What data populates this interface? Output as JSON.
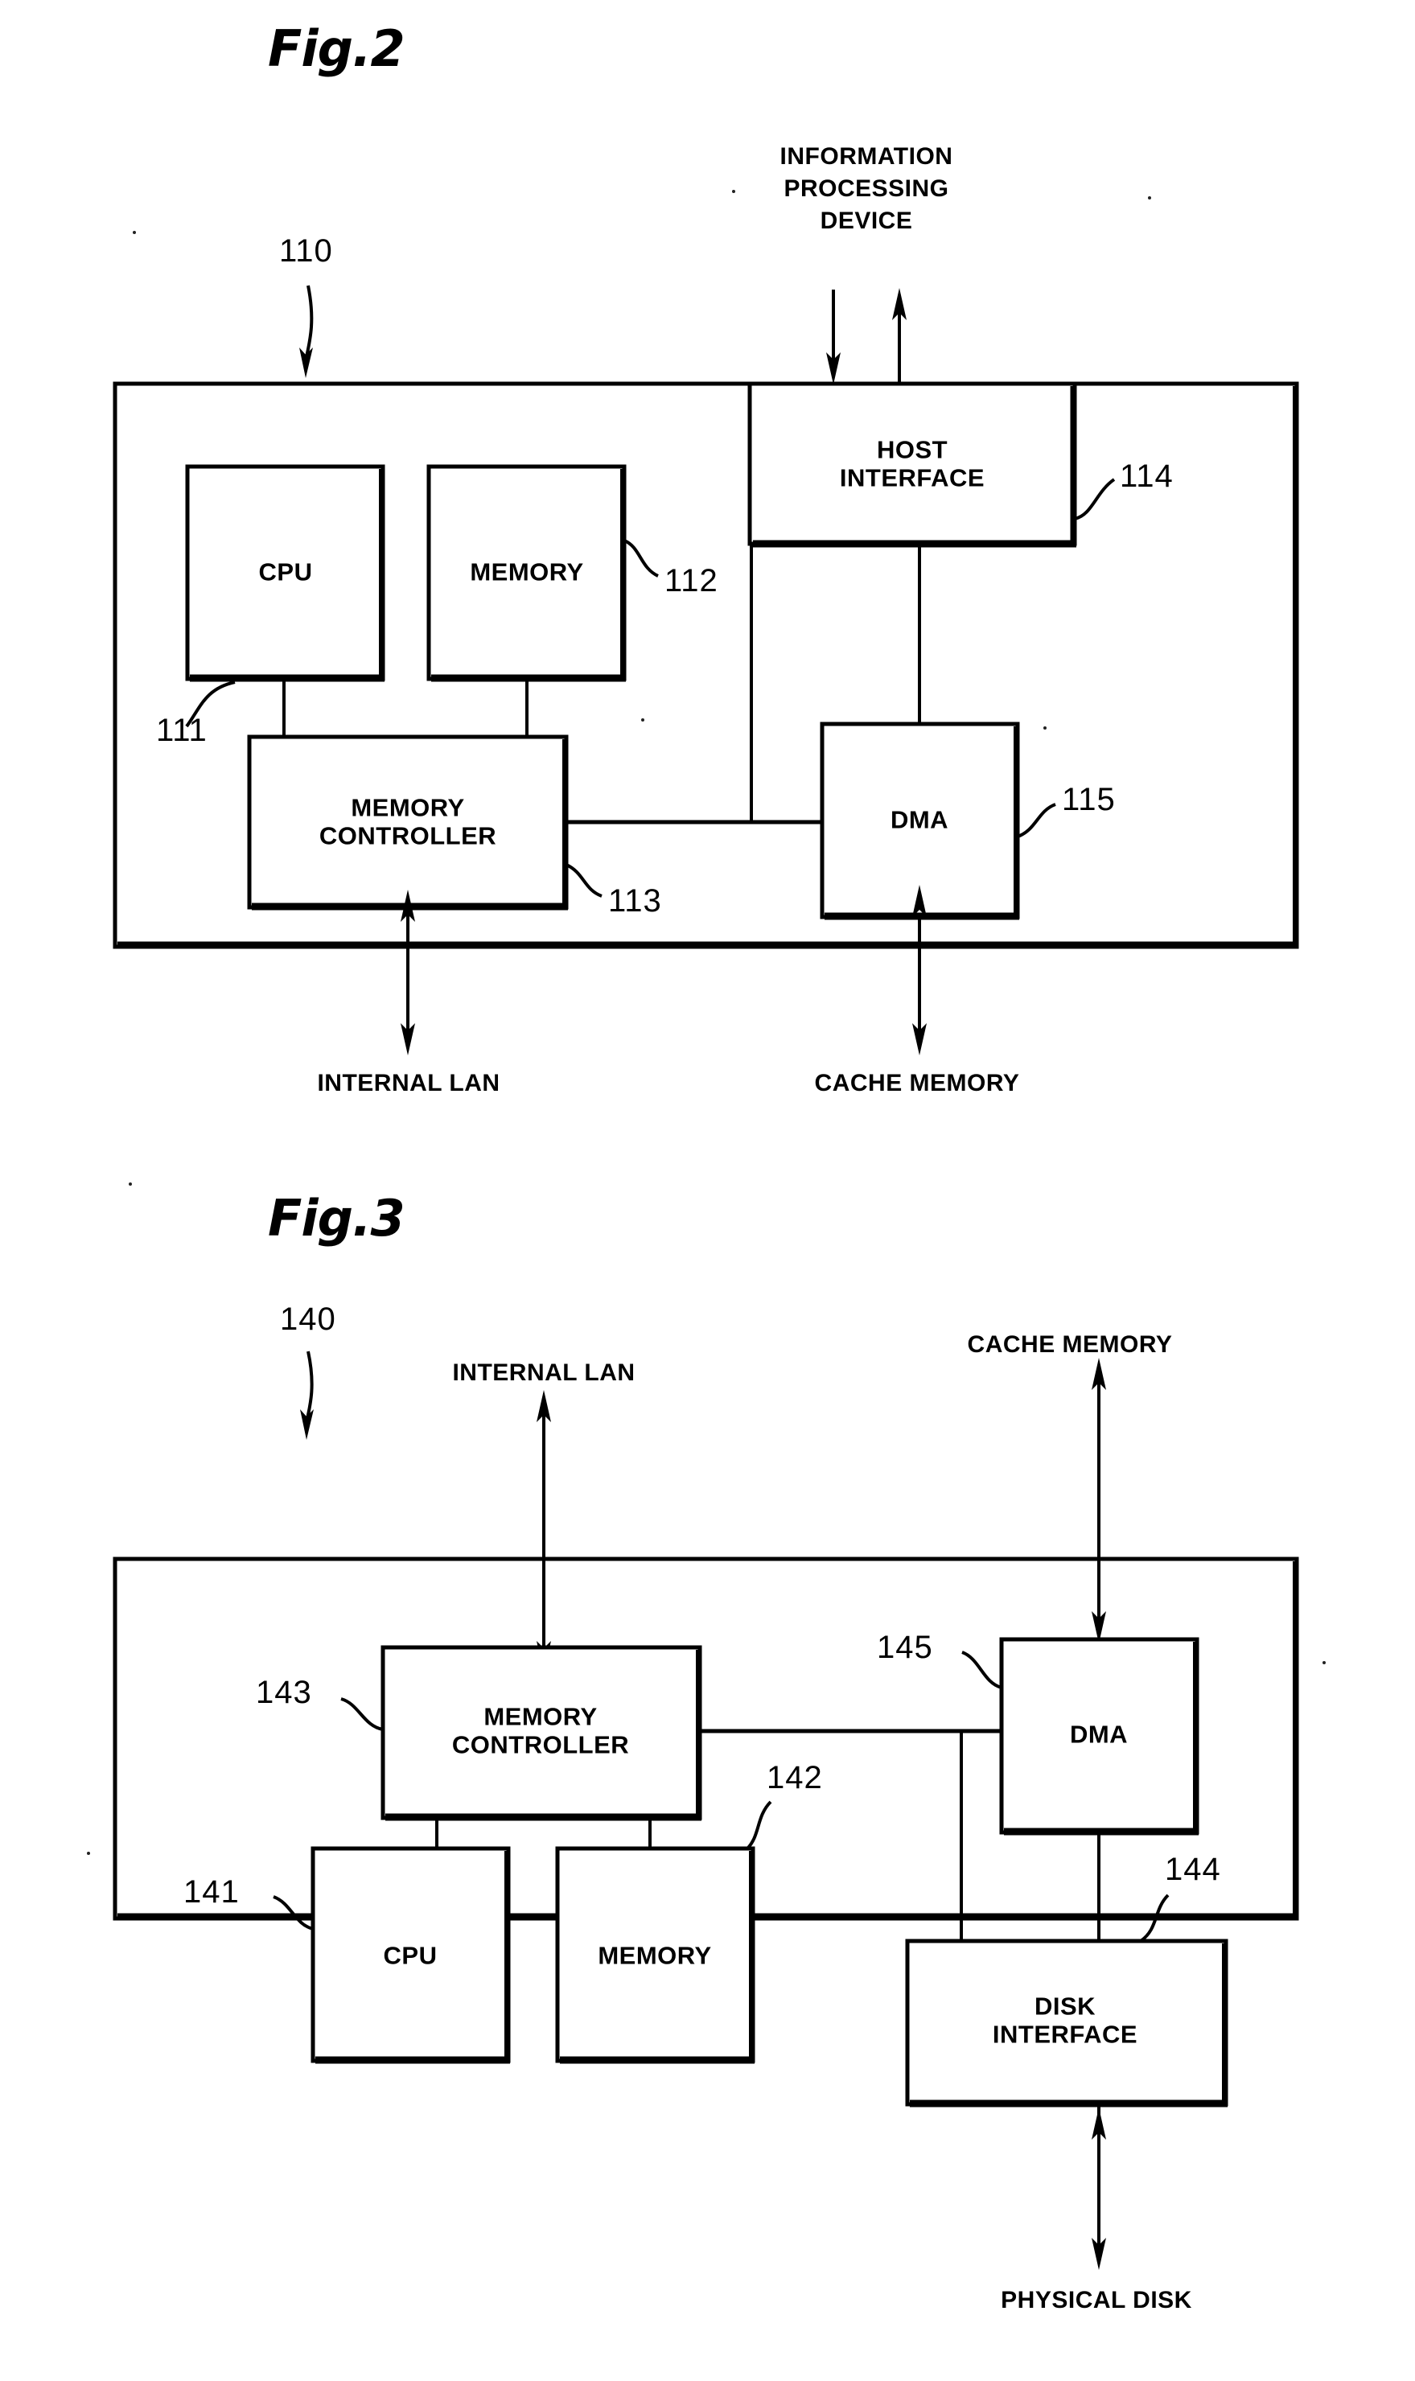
{
  "document": {
    "type": "patent-figure-sheet",
    "figures": [
      {
        "id": "fig2",
        "title": "Fig.2",
        "reference_numeral": "110",
        "external_labels": [
          {
            "name": "information-processing-device",
            "text": "INFORMATION\nPROCESSING\nDEVICE",
            "position": "top"
          },
          {
            "name": "internal-lan",
            "text": "INTERNAL LAN",
            "position": "bottom-left"
          },
          {
            "name": "cache-memory",
            "text": "CACHE MEMORY",
            "position": "bottom-right"
          }
        ],
        "blocks": [
          {
            "name": "cpu",
            "label": "CPU",
            "ref": "111"
          },
          {
            "name": "memory",
            "label": "MEMORY",
            "ref": "112"
          },
          {
            "name": "memory-controller",
            "label": "MEMORY\nCONTROLLER",
            "ref": "113"
          },
          {
            "name": "host-interface",
            "label": "HOST\nINTERFACE",
            "ref": "114"
          },
          {
            "name": "dma",
            "label": "DMA",
            "ref": "115"
          }
        ]
      },
      {
        "id": "fig3",
        "title": "Fig.3",
        "reference_numeral": "140",
        "external_labels": [
          {
            "name": "internal-lan",
            "text": "INTERNAL LAN",
            "position": "top-left"
          },
          {
            "name": "cache-memory",
            "text": "CACHE MEMORY",
            "position": "top-right"
          },
          {
            "name": "physical-disk",
            "text": "PHYSICAL DISK",
            "position": "bottom"
          }
        ],
        "blocks": [
          {
            "name": "memory-controller",
            "label": "MEMORY\nCONTROLLER",
            "ref": "143"
          },
          {
            "name": "dma",
            "label": "DMA",
            "ref": "145"
          },
          {
            "name": "cpu",
            "label": "CPU",
            "ref": "141"
          },
          {
            "name": "memory",
            "label": "MEMORY",
            "ref": "142"
          },
          {
            "name": "disk-interface",
            "label": "DISK\nINTERFACE",
            "ref": "144"
          }
        ]
      }
    ],
    "colors": {
      "ink": "#000000",
      "paper": "#ffffff"
    }
  },
  "fig2": {
    "title": "Fig.2",
    "ref_110": "110",
    "info_proc_line1": "INFORMATION",
    "info_proc_line2": "PROCESSING",
    "info_proc_line3": "DEVICE",
    "cpu": "CPU",
    "memory": "MEMORY",
    "memory_controller": "MEMORY\nCONTROLLER",
    "host_interface": "HOST\nINTERFACE",
    "dma": "DMA",
    "ref_111": "111",
    "ref_112": "112",
    "ref_113": "113",
    "ref_114": "114",
    "ref_115": "115",
    "internal_lan": "INTERNAL LAN",
    "cache_memory": "CACHE MEMORY"
  },
  "fig3": {
    "title": "Fig.3",
    "ref_140": "140",
    "internal_lan": "INTERNAL LAN",
    "cache_memory": "CACHE MEMORY",
    "memory_controller": "MEMORY\nCONTROLLER",
    "dma": "DMA",
    "cpu": "CPU",
    "memory": "MEMORY",
    "disk_interface": "DISK\nINTERFACE",
    "ref_141": "141",
    "ref_142": "142",
    "ref_143": "143",
    "ref_144": "144",
    "ref_145": "145",
    "physical_disk": "PHYSICAL DISK"
  }
}
